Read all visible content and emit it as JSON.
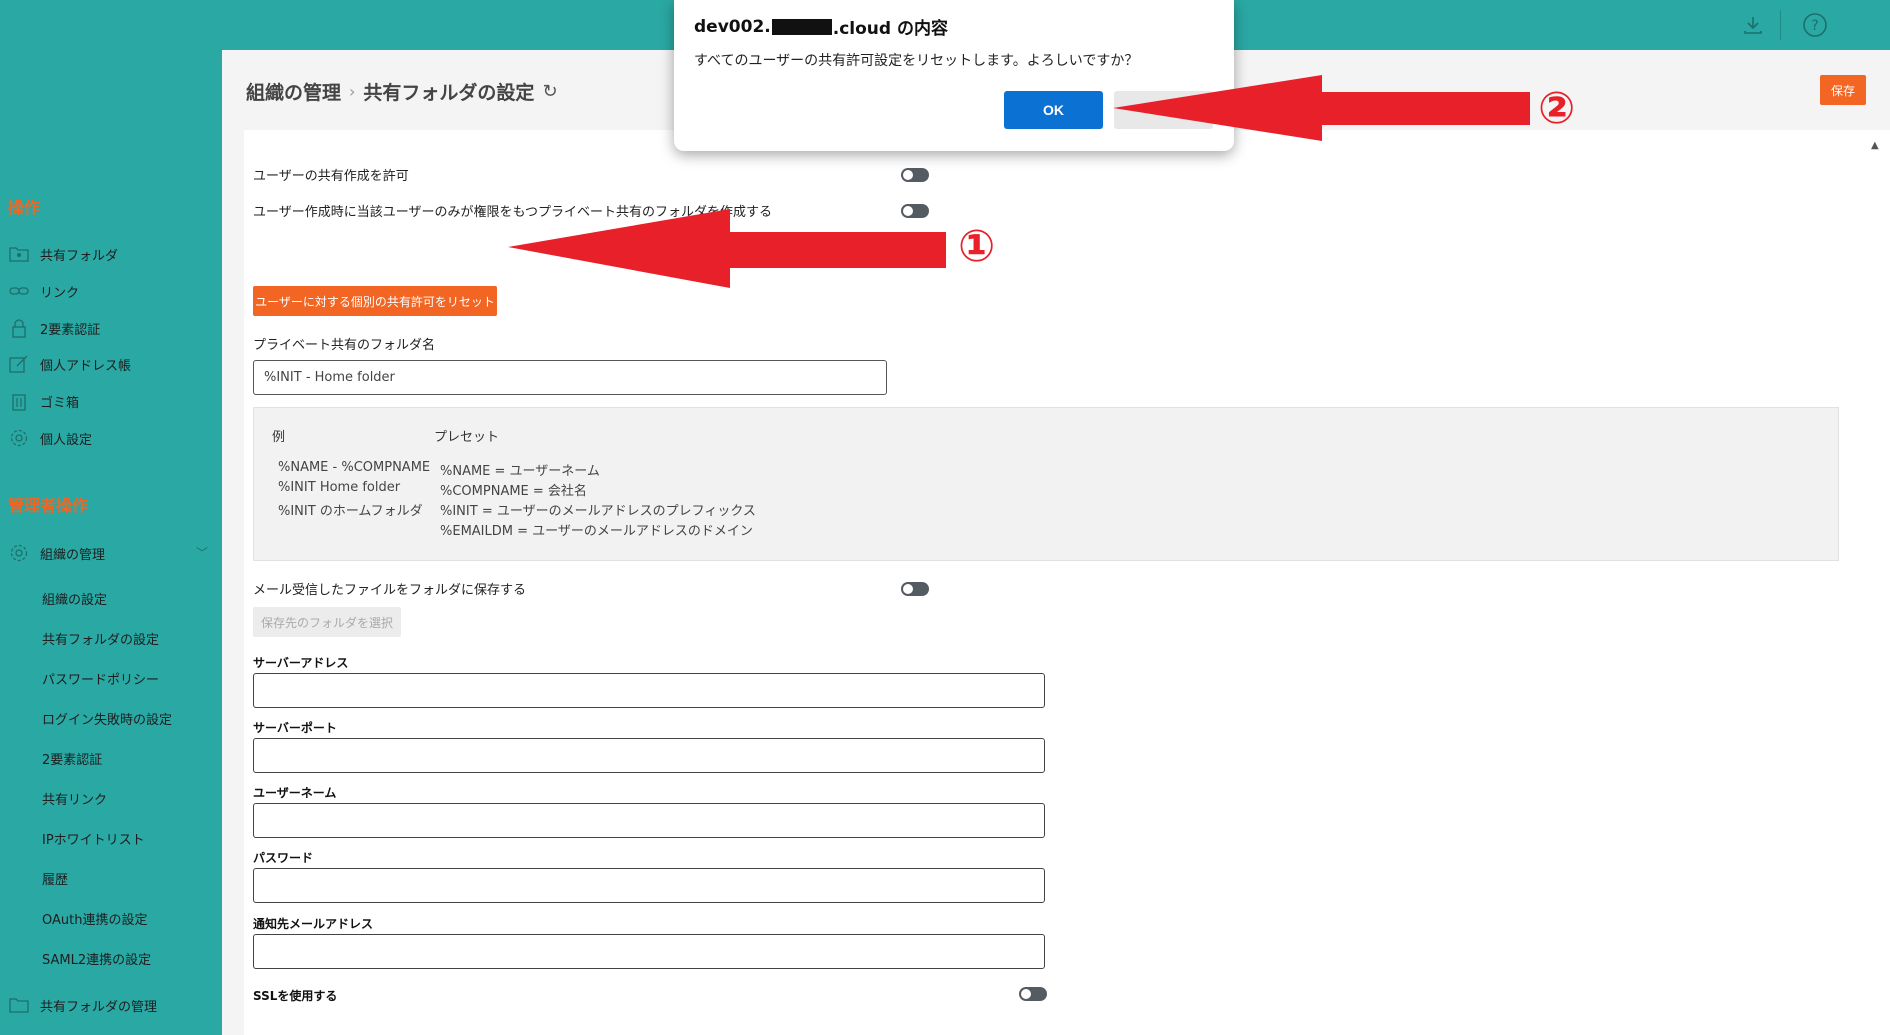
{
  "sidebar": {
    "section_ops": "操作",
    "items": [
      {
        "label": "共有フォルダ",
        "icon": "folder-user-icon"
      },
      {
        "label": "リンク",
        "icon": "link-icon"
      },
      {
        "label": "2要素認証",
        "icon": "lock-icon"
      },
      {
        "label": "個人アドレス帳",
        "icon": "edit-icon"
      },
      {
        "label": "ゴミ箱",
        "icon": "trash-icon"
      },
      {
        "label": "個人設定",
        "icon": "gear-icon"
      }
    ],
    "section_admin": "管理者操作",
    "org_mgmt": "組織の管理",
    "sub_items": [
      "組織の設定",
      "共有フォルダの設定",
      "パスワードポリシー",
      "ログイン失敗時の設定",
      "2要素認証",
      "共有リンク",
      "IPホワイトリスト",
      "履歴",
      "OAuth連携の設定",
      "SAML2連携の設定"
    ],
    "shared_folder_mgmt": "共有フォルダの管理"
  },
  "header": {
    "crumb1": "組織の管理",
    "crumb_sep": "›",
    "crumb2": "共有フォルダの設定",
    "save_label": "保存"
  },
  "settings": {
    "allow_user_share": "ユーザーの共有作成を許可",
    "create_private_folder": "ユーザー作成時に当該ユーザーのみが権限をもつプライベート共有のフォルダを作成する",
    "reset_button": "ユーザーに対する個別の共有許可をリセット",
    "private_folder_name_label": "プライベート共有のフォルダ名",
    "private_folder_name_value": "%INIT - Home folder",
    "example": {
      "head_example": "例",
      "head_preset": "プレセット",
      "examples": [
        "%NAME - %COMPNAME",
        "%INIT Home folder",
        "%INIT のホームフォルダ"
      ],
      "presets": [
        "%NAME = ユーザーネーム",
        "%COMPNAME = 会社名",
        "%INIT = ユーザーのメールアドレスのプレフィックス",
        "%EMAILDM = ユーザーのメールアドレスのドメイン"
      ]
    },
    "save_mail_files": "メール受信したファイルをフォルダに保存する",
    "select_folder_button": "保存先のフォルダを選択",
    "server_address": "サーバーアドレス",
    "server_port": "サーバーポート",
    "username": "ユーザーネーム",
    "password": "パスワード",
    "notify_email": "通知先メールアドレス",
    "use_ssl": "SSLを使用する"
  },
  "dialog": {
    "title_prefix": "dev002.",
    "title_suffix": ".cloud の内容",
    "message": "すべてのユーザーの共有許可設定をリセットします。よろしいですか？",
    "ok_label": "OK"
  },
  "annotations": {
    "num1": "①",
    "num2": "②"
  }
}
